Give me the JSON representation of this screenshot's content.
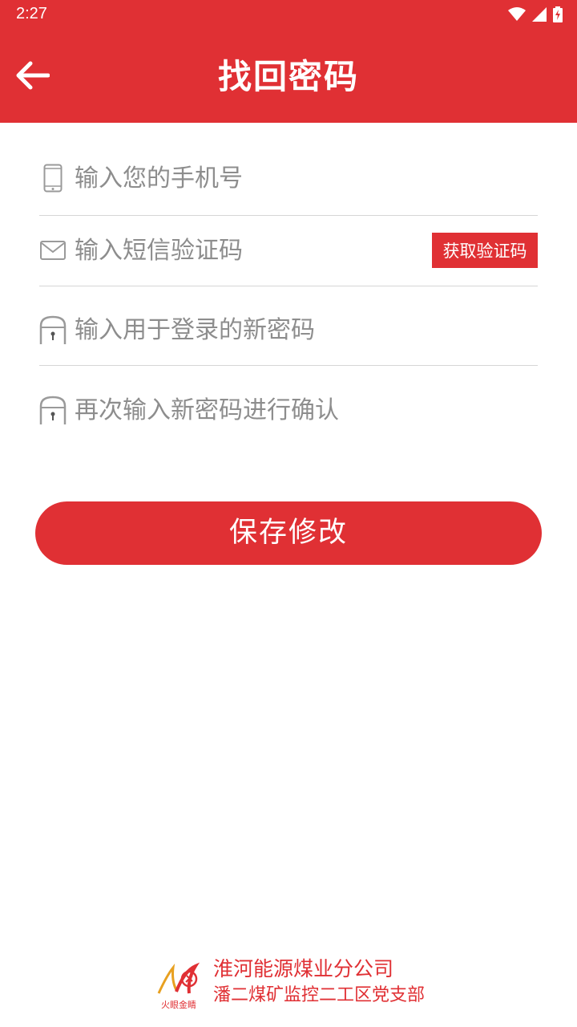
{
  "status_bar": {
    "time": "2:27",
    "icons": [
      "wifi-icon",
      "signal-icon",
      "battery-charging-icon"
    ]
  },
  "header": {
    "back_icon": "arrow-left-icon",
    "title": "找回密码"
  },
  "form": {
    "phone": {
      "icon": "phone-icon",
      "placeholder": "输入您的手机号",
      "value": ""
    },
    "sms_code": {
      "icon": "envelope-icon",
      "placeholder": "输入短信验证码",
      "value": "",
      "get_code_label": "获取验证码"
    },
    "new_password": {
      "icon": "lock-icon",
      "placeholder": "输入用于登录的新密码",
      "value": ""
    },
    "confirm_password": {
      "icon": "lock-icon",
      "placeholder": "再次输入新密码进行确认",
      "value": ""
    }
  },
  "save_label": "保存修改",
  "footer": {
    "logo_text": "火眼金睛",
    "line1": "淮河能源煤业分公司",
    "line2": "潘二煤矿监控二工区党支部"
  },
  "colors": {
    "primary": "#e03034",
    "placeholder": "#8d8d8d",
    "divider": "#d6d6d6"
  }
}
